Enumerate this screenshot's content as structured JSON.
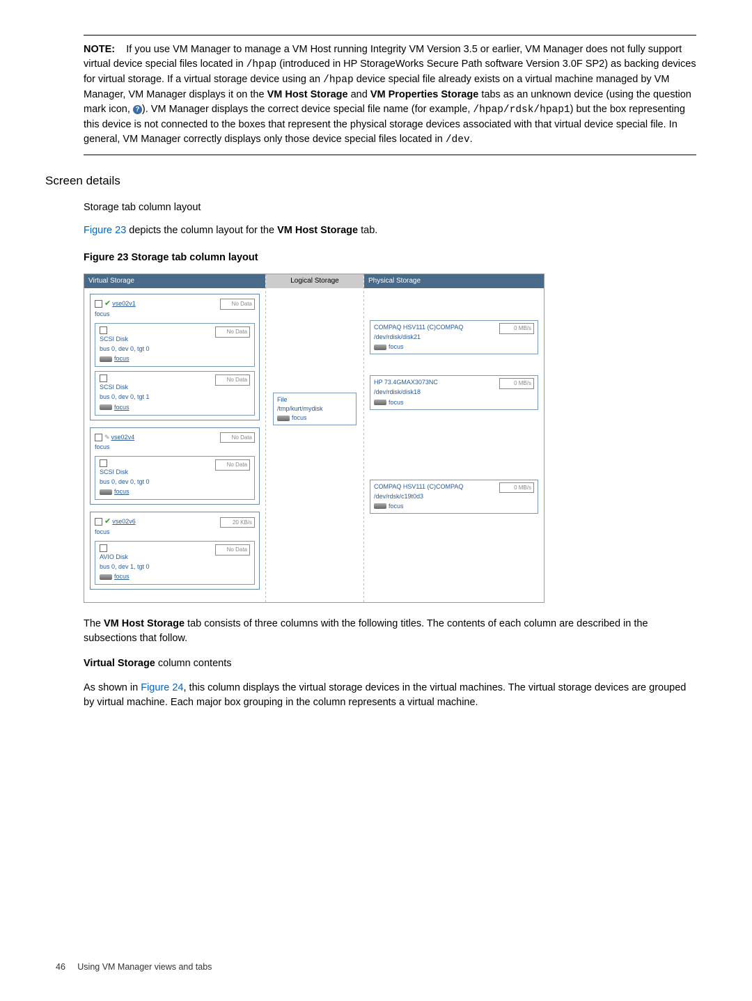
{
  "note": {
    "label": "NOTE:",
    "text1": "If you use VM Manager to manage a VM Host running Integrity VM Version 3.5 or earlier, VM Manager does not fully support virtual device special files located in ",
    "mono1": "/hpap",
    "text2": " (introduced in HP StorageWorks Secure Path software Version 3.0F SP2) as backing devices for virtual storage. If a virtual storage device using an ",
    "mono2": "/hpap",
    "text3": " device special file already exists on a virtual machine managed by VM Manager, VM Manager displays it on the ",
    "bold1": "VM Host Storage",
    "text4": " and ",
    "bold2": "VM Properties Storage",
    "text5": " tabs as an unknown device (using the question mark icon, ",
    "iconChar": "?",
    "text6": "). VM Manager displays the correct device special file name (for example, ",
    "mono3": "/hpap/rdsk/hpap1",
    "text7": ") but the box representing this device is not connected to the boxes that represent the physical storage devices associated with that virtual device special file. In general, VM Manager correctly displays only those device special files located in ",
    "mono4": "/dev",
    "text8": "."
  },
  "screenDetails": "Screen details",
  "stcl": "Storage tab column layout",
  "figLink": "Figure 23",
  "figLine2": " depicts the column layout for the ",
  "figBold": "VM Host Storage",
  "figLine3": " tab.",
  "figCaption": "Figure 23 Storage tab column layout",
  "cols": {
    "virtual": "Virtual Storage",
    "logical": "Logical Storage",
    "physical": "Physical Storage"
  },
  "vm1": {
    "name": "vse02v1",
    "focus": "focus",
    "nodata": "No Data",
    "disk1": {
      "type": "SCSI Disk",
      "loc": "bus 0, dev 0, tgt 0",
      "nodata": "No Data",
      "focus": "focus"
    },
    "disk2": {
      "type": "SCSI Disk",
      "loc": "bus 0, dev 0, tgt 1",
      "nodata": "No Data",
      "focus": "focus"
    }
  },
  "vm2": {
    "name": "vse02v4",
    "focus": "focus",
    "nodata": "No Data",
    "disk1": {
      "type": "SCSI Disk",
      "loc": "bus 0, dev 0, tgt 0",
      "nodata": "No Data",
      "focus": "focus"
    }
  },
  "vm3": {
    "name": "vse02v6",
    "focus": "focus",
    "rate": "20 KB/s",
    "disk1": {
      "type": "AVIO Disk",
      "loc": "bus 0, dev 1, tgt 0",
      "nodata": "No Data",
      "focus": "focus"
    }
  },
  "logicalBox": {
    "title": "File",
    "path": "/tmp/kurt/mydisk",
    "focus": "focus"
  },
  "phys1": {
    "title": "COMPAQ HSV111 (C)COMPAQ",
    "path": "/dev/rdisk/disk21",
    "focus": "focus",
    "rate": "0 MB/s"
  },
  "phys2": {
    "title": "HP 73.4GMAX3073NC",
    "path": "/dev/rdisk/disk18",
    "focus": "focus",
    "rate": "0 MB/s"
  },
  "phys3": {
    "title": "COMPAQ HSV111 (C)COMPAQ",
    "path": "/dev/rdsk/c19t0d3",
    "focus": "focus",
    "rate": "0 MB/s"
  },
  "afterFig1a": "The ",
  "afterFigBold": "VM Host Storage",
  "afterFig1b": " tab consists of three columns with the following titles. The contents of each column are described in the subsections that follow.",
  "vsHeading": "Virtual Storage",
  "vsHeading2": " column contents",
  "lastP1": "As shown in ",
  "lastLink": "Figure 24",
  "lastP2": ", this column displays the virtual storage devices in the virtual machines. The virtual storage devices are grouped by virtual machine. Each major box grouping in the column represents a virtual machine.",
  "footerPage": "46",
  "footerText": "Using VM Manager views and tabs"
}
